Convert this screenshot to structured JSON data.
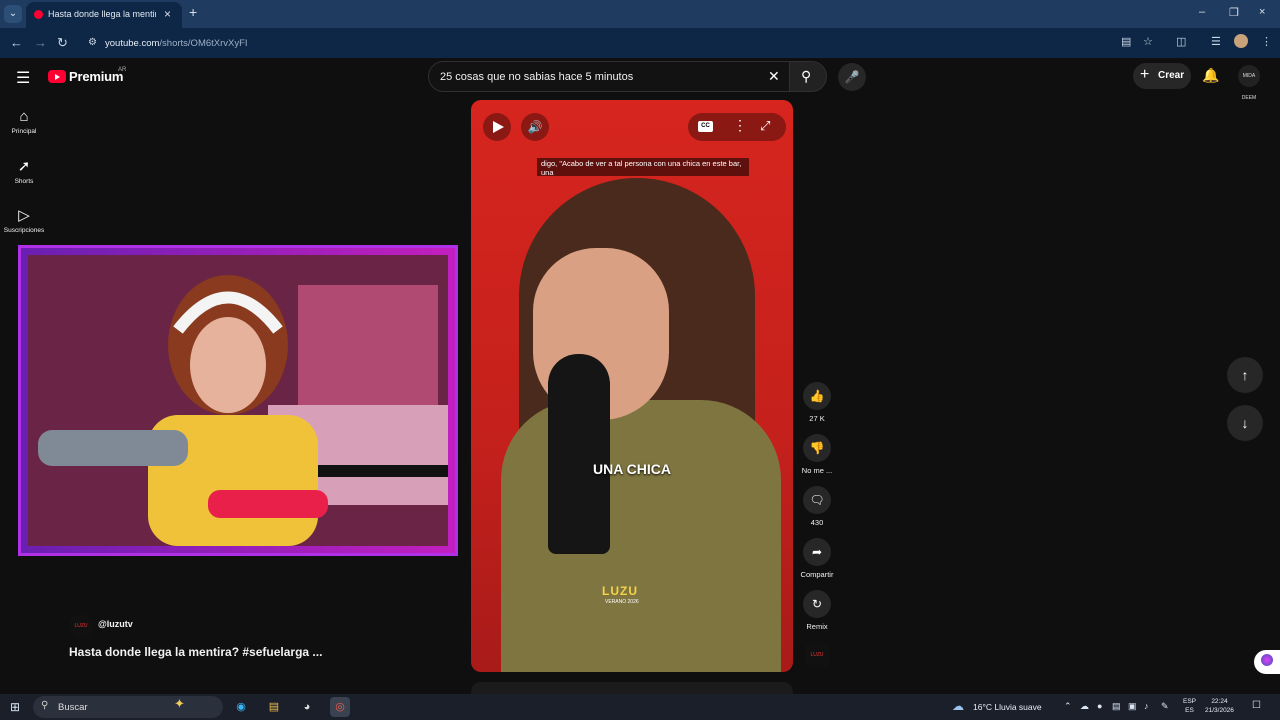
{
  "browser": {
    "tab_title": "Hasta donde llega la mentira? #",
    "url_host": "youtube.com",
    "url_path": "/shorts/OM6tXrvXyFI"
  },
  "header": {
    "logo_text": "Premium",
    "country": "AR",
    "search_value": "25 cosas que no sabias hace 5 minutos",
    "create_label": "Crear",
    "avatar_text": "MIDA DEEM"
  },
  "sidebar": {
    "items": [
      {
        "label": "Principal",
        "icon": "home-icon"
      },
      {
        "label": "Shorts",
        "icon": "shorts-icon"
      },
      {
        "label": "Suscripciones",
        "icon": "subscriptions-icon"
      }
    ]
  },
  "video": {
    "caption": "digo, \"Acabo de ver a tal persona con una chica en este bar, una",
    "overlay_text": "UNA CHICA",
    "brand": "LUZU",
    "brand_sub": "VERANO 2026"
  },
  "actions": {
    "likes": "27 K",
    "dislike_label": "No me ...",
    "comments": "430",
    "share_label": "Compartir",
    "remix_label": "Remix"
  },
  "channel": {
    "name": "@luzutv",
    "title": "Hasta donde llega la mentira? #sefuelarga ...",
    "thumb_text": "LUZU"
  },
  "taskbar": {
    "search_placeholder": "Buscar",
    "weather": "16°C  Lluvia suave",
    "lang_1": "ESP",
    "lang_2": "ES",
    "time": "22:24",
    "date": "21/3/2026"
  },
  "colors": {
    "youtube_red": "#ff0033",
    "video_bg": "#d7251e",
    "overlay_border": "#b030e8",
    "browser_chrome": "#0e2746"
  }
}
